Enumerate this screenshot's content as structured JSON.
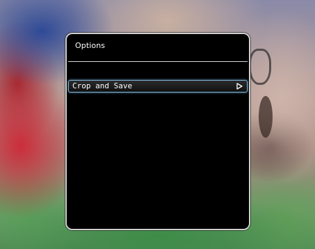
{
  "dialog": {
    "title": "Options",
    "menu": {
      "items": [
        {
          "label": "Crop and Save",
          "icon": "play-arrow-icon",
          "selected": true
        }
      ]
    }
  },
  "colors": {
    "dialog_background": "#000000",
    "dialog_border": "#cfcfcf",
    "selection_border": "#7fb3d8",
    "text": "#ffffff"
  }
}
